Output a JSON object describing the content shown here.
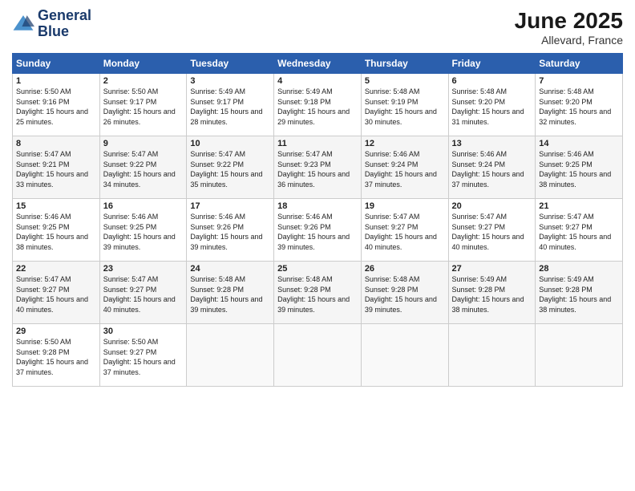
{
  "logo": {
    "line1": "General",
    "line2": "Blue"
  },
  "title": "June 2025",
  "location": "Allevard, France",
  "days_header": [
    "Sunday",
    "Monday",
    "Tuesday",
    "Wednesday",
    "Thursday",
    "Friday",
    "Saturday"
  ],
  "weeks": [
    [
      {
        "day": "1",
        "rise": "5:50 AM",
        "set": "9:16 PM",
        "hours": "15 hours and 25 minutes."
      },
      {
        "day": "2",
        "rise": "5:50 AM",
        "set": "9:17 PM",
        "hours": "15 hours and 26 minutes."
      },
      {
        "day": "3",
        "rise": "5:49 AM",
        "set": "9:17 PM",
        "hours": "15 hours and 28 minutes."
      },
      {
        "day": "4",
        "rise": "5:49 AM",
        "set": "9:18 PM",
        "hours": "15 hours and 29 minutes."
      },
      {
        "day": "5",
        "rise": "5:48 AM",
        "set": "9:19 PM",
        "hours": "15 hours and 30 minutes."
      },
      {
        "day": "6",
        "rise": "5:48 AM",
        "set": "9:20 PM",
        "hours": "15 hours and 31 minutes."
      },
      {
        "day": "7",
        "rise": "5:48 AM",
        "set": "9:20 PM",
        "hours": "15 hours and 32 minutes."
      }
    ],
    [
      {
        "day": "8",
        "rise": "5:47 AM",
        "set": "9:21 PM",
        "hours": "15 hours and 33 minutes."
      },
      {
        "day": "9",
        "rise": "5:47 AM",
        "set": "9:22 PM",
        "hours": "15 hours and 34 minutes."
      },
      {
        "day": "10",
        "rise": "5:47 AM",
        "set": "9:22 PM",
        "hours": "15 hours and 35 minutes."
      },
      {
        "day": "11",
        "rise": "5:47 AM",
        "set": "9:23 PM",
        "hours": "15 hours and 36 minutes."
      },
      {
        "day": "12",
        "rise": "5:46 AM",
        "set": "9:24 PM",
        "hours": "15 hours and 37 minutes."
      },
      {
        "day": "13",
        "rise": "5:46 AM",
        "set": "9:24 PM",
        "hours": "15 hours and 37 minutes."
      },
      {
        "day": "14",
        "rise": "5:46 AM",
        "set": "9:25 PM",
        "hours": "15 hours and 38 minutes."
      }
    ],
    [
      {
        "day": "15",
        "rise": "5:46 AM",
        "set": "9:25 PM",
        "hours": "15 hours and 38 minutes."
      },
      {
        "day": "16",
        "rise": "5:46 AM",
        "set": "9:25 PM",
        "hours": "15 hours and 39 minutes."
      },
      {
        "day": "17",
        "rise": "5:46 AM",
        "set": "9:26 PM",
        "hours": "15 hours and 39 minutes."
      },
      {
        "day": "18",
        "rise": "5:46 AM",
        "set": "9:26 PM",
        "hours": "15 hours and 39 minutes."
      },
      {
        "day": "19",
        "rise": "5:47 AM",
        "set": "9:27 PM",
        "hours": "15 hours and 40 minutes."
      },
      {
        "day": "20",
        "rise": "5:47 AM",
        "set": "9:27 PM",
        "hours": "15 hours and 40 minutes."
      },
      {
        "day": "21",
        "rise": "5:47 AM",
        "set": "9:27 PM",
        "hours": "15 hours and 40 minutes."
      }
    ],
    [
      {
        "day": "22",
        "rise": "5:47 AM",
        "set": "9:27 PM",
        "hours": "15 hours and 40 minutes."
      },
      {
        "day": "23",
        "rise": "5:47 AM",
        "set": "9:27 PM",
        "hours": "15 hours and 40 minutes."
      },
      {
        "day": "24",
        "rise": "5:48 AM",
        "set": "9:28 PM",
        "hours": "15 hours and 39 minutes."
      },
      {
        "day": "25",
        "rise": "5:48 AM",
        "set": "9:28 PM",
        "hours": "15 hours and 39 minutes."
      },
      {
        "day": "26",
        "rise": "5:48 AM",
        "set": "9:28 PM",
        "hours": "15 hours and 39 minutes."
      },
      {
        "day": "27",
        "rise": "5:49 AM",
        "set": "9:28 PM",
        "hours": "15 hours and 38 minutes."
      },
      {
        "day": "28",
        "rise": "5:49 AM",
        "set": "9:28 PM",
        "hours": "15 hours and 38 minutes."
      }
    ],
    [
      {
        "day": "29",
        "rise": "5:50 AM",
        "set": "9:28 PM",
        "hours": "15 hours and 37 minutes."
      },
      {
        "day": "30",
        "rise": "5:50 AM",
        "set": "9:27 PM",
        "hours": "15 hours and 37 minutes."
      },
      null,
      null,
      null,
      null,
      null
    ]
  ],
  "labels": {
    "sunrise": "Sunrise: ",
    "sunset": "Sunset: ",
    "daylight": "Daylight: "
  }
}
